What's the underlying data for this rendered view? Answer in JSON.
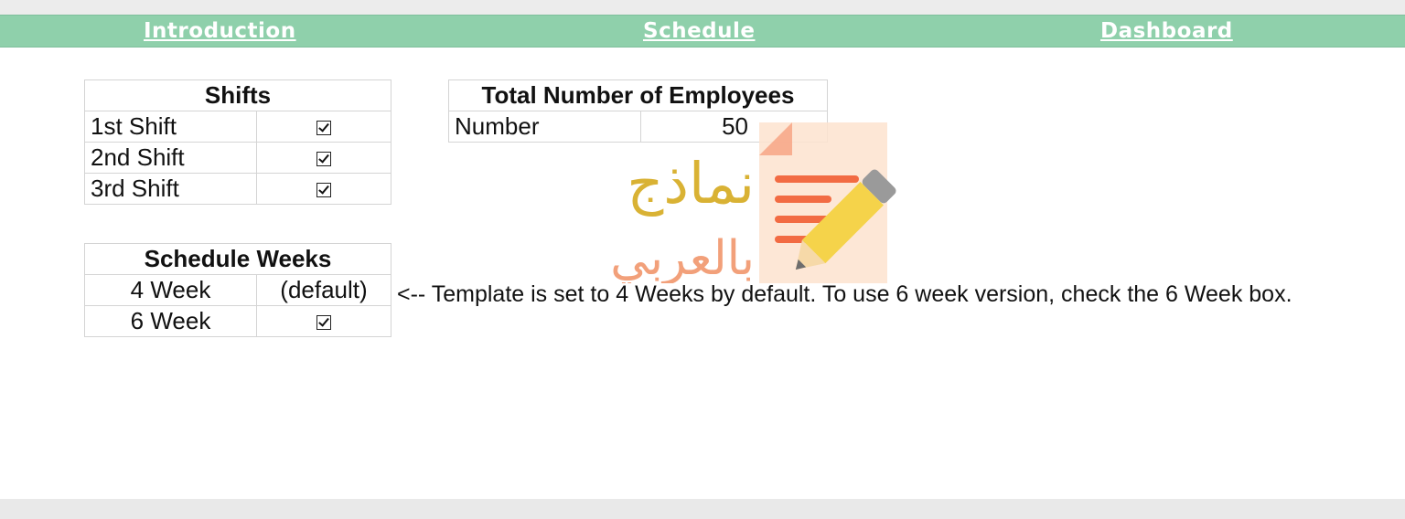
{
  "nav": {
    "introduction": "Introduction",
    "schedule": "Schedule",
    "dashboard": "Dashboard",
    "bar_color": "#8fd0ab"
  },
  "shifts": {
    "title": "Shifts",
    "rows": [
      {
        "label": "1st Shift",
        "checked": true
      },
      {
        "label": "2nd Shift",
        "checked": true
      },
      {
        "label": "3rd Shift",
        "checked": true
      }
    ]
  },
  "employees": {
    "title": "Total Number of Employees",
    "label": "Number",
    "value": "50"
  },
  "schedule_weeks": {
    "title": "Schedule Weeks",
    "rows": [
      {
        "label": "4 Week",
        "value": "(default)"
      },
      {
        "label": "6 Week",
        "checked": true
      }
    ],
    "note": "<-- Template is set to 4 Weeks by default. To use 6 week version, check the 6 Week box."
  },
  "watermark": {
    "line1": "نماذج",
    "line2": "بالعربي",
    "icon": "document-pencil-icon"
  }
}
